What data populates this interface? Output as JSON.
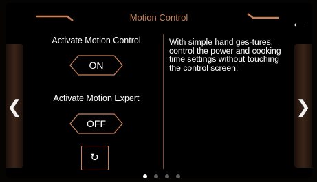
{
  "header": {
    "title": "Motion Control",
    "back_icon": "arrow-left-icon"
  },
  "navigation": {
    "prev_icon": "chevron-left-icon",
    "next_icon": "chevron-right-icon",
    "page_count": 4,
    "active_page": 1
  },
  "settings": [
    {
      "label": "Activate Motion Control",
      "value": "ON"
    },
    {
      "label": "Activate Motion Expert",
      "value": "OFF"
    }
  ],
  "description": "With simple hand ges-tures, control the power and cooking time settings without touching the control screen.",
  "reset": {
    "icon": "reset-icon"
  },
  "colors": {
    "accent": "#c98258",
    "background": "#000000",
    "text": "#ffffff"
  }
}
